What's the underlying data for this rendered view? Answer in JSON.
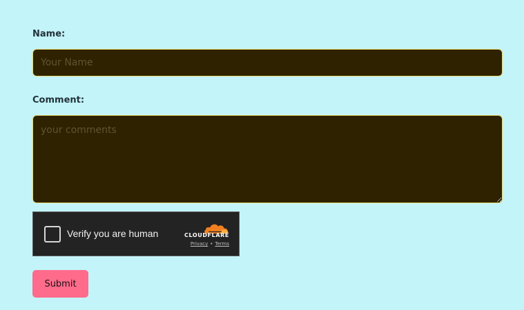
{
  "form": {
    "name_label": "Name:",
    "name_placeholder": "Your Name",
    "comment_label": "Comment:",
    "comment_placeholder": "your comments",
    "submit_label": "Submit"
  },
  "captcha": {
    "checkbox_label": "Verify you are human",
    "brand": "CLOUDFLARE",
    "privacy_link": "Privacy",
    "separator": "•",
    "terms_link": "Terms",
    "checked": false
  },
  "colors": {
    "page_background": "#c3f4f9",
    "field_background": "#2f2200",
    "field_border": "#e7d76a",
    "captcha_background": "#232323",
    "cloudflare_orange": "#f38020",
    "submit_background": "#ff6b8b"
  },
  "icons": {
    "captcha_logo": "cloudflare-cloud-icon"
  }
}
